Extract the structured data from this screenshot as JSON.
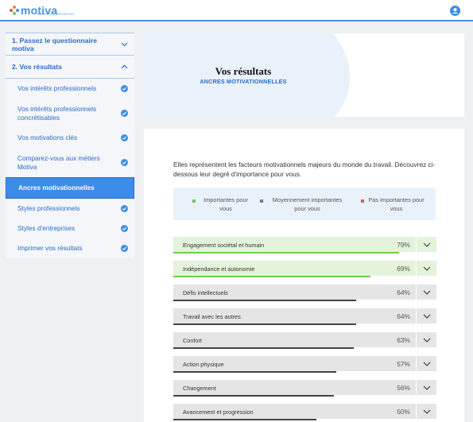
{
  "brand": {
    "name": "motiva",
    "tagline": "WORKING ORIENTATION",
    "color": "#4a90e2"
  },
  "sidebar": {
    "sections": [
      {
        "label": "1. Passez le questionnaire motiva",
        "icon": "chevron-down-icon"
      },
      {
        "label": "2. Vos résultats",
        "icon": "chevron-up-icon"
      }
    ],
    "items": [
      {
        "label": "Vos intérêts professionnels",
        "done": true
      },
      {
        "label": "Vos intérêts professionnels concrétisables",
        "done": true
      },
      {
        "label": "Vos motivations clés",
        "done": true
      },
      {
        "label": "Comparez-vous aux métiers Motiva",
        "done": true
      },
      {
        "label": "Ancres motivationnelles",
        "done": false,
        "active": true
      },
      {
        "label": "Styles professionnels",
        "done": true
      },
      {
        "label": "Styles d'entreprises",
        "done": true
      },
      {
        "label": "Imprimer vos résultats",
        "done": true
      }
    ]
  },
  "header": {
    "title": "Vos résultats",
    "subtitle": "ANCRES MOTIVATIONNELLES"
  },
  "intro": "Elles représentent les facteurs motivationnels majeurs du monde du travail. Découvrez ci-dessous leur degré d'importance pour vous.",
  "legend": [
    {
      "label": "Importantes pour vous",
      "color": "#7ac55a"
    },
    {
      "label": "Moyennement importantes pour vous",
      "color": "#7a7a7a"
    },
    {
      "label": "Pas importantes pour vous",
      "color": "#e05555"
    }
  ],
  "anchors": [
    {
      "name": "Engagement sociétal et humain",
      "percent": 79,
      "pct_label": "79%",
      "level": "important"
    },
    {
      "name": "Indépendance et autonomie",
      "percent": 69,
      "pct_label": "69%",
      "level": "important"
    },
    {
      "name": "Défis intellectuels",
      "percent": 64,
      "pct_label": "64%",
      "level": "medium"
    },
    {
      "name": "Travail avec les autres",
      "percent": 64,
      "pct_label": "64%",
      "level": "medium"
    },
    {
      "name": "Confort",
      "percent": 63,
      "pct_label": "63%",
      "level": "medium"
    },
    {
      "name": "Action physique",
      "percent": 57,
      "pct_label": "57%",
      "level": "medium"
    },
    {
      "name": "Changement",
      "percent": 56,
      "pct_label": "56%",
      "level": "medium"
    },
    {
      "name": "Avancement et progression",
      "percent": 50,
      "pct_label": "50%",
      "level": "medium"
    }
  ]
}
